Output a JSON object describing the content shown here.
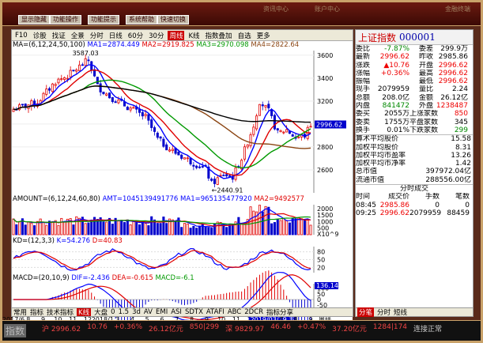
{
  "topbar": {
    "buttons": [
      "显示隐藏",
      "功能操作",
      "功能提示",
      "系统帮助",
      "快速切换"
    ],
    "dim": [
      "资讯中心",
      "账户中心"
    ],
    "right": "金融终端"
  },
  "toolbar": {
    "items": [
      "F10",
      "诊股",
      "找证",
      "全景",
      "分时",
      "日线",
      "60分",
      "30分",
      "周线",
      "K线",
      "指数叠加",
      "自选",
      "更多"
    ],
    "active": "周线"
  },
  "price": {
    "legend": {
      "title": "MA=(6,12,24,50,100)",
      "ma1": "MA1=2874.449",
      "ma2": "MA2=2919.825",
      "ma3": "MA3=2970.098",
      "ma4": "MA4=2822.64"
    },
    "high_label": "3587.03",
    "low_label": "2440.91",
    "yticks": [
      "3600",
      "3400",
      "3200",
      "3000",
      "2800",
      "2600"
    ],
    "last_box": "2996.62"
  },
  "volume": {
    "legend": {
      "title": "AMOUNT=(6,12,24,60,80)",
      "amt": "AMT=1045139491776",
      "ma1": "MA1=965135477920",
      "ma2": "MA2=9492577"
    },
    "yticks": [
      "2000",
      "1500",
      "1000",
      "500"
    ],
    "unit": "X10^9"
  },
  "kd": {
    "legend": {
      "title": "KD=(12,3,3)",
      "k": "K=54.276",
      "d": "D=40.83"
    },
    "yticks": [
      "80",
      "50",
      "20"
    ]
  },
  "macd": {
    "legend": {
      "title": "MACD=(20,10,9)",
      "dif": "DIF=-2.436",
      "dea": "DEA=-0.615",
      "macd": "MACD=-6.1"
    },
    "box": "136.14",
    "yticks": [
      "100",
      "50",
      "0",
      "-50",
      "-100"
    ]
  },
  "xaxis": {
    "labels": [
      "2017/6",
      "8",
      "9",
      "10",
      "11",
      "12",
      "2018/1",
      "3",
      "4",
      "5",
      "6",
      "7",
      "8",
      "9",
      "10",
      "11",
      "12",
      "2019/03/29 五",
      "7",
      "8",
      "9"
    ],
    "period": "周线"
  },
  "bottombar": {
    "items": [
      "常用",
      "指标",
      "技术指标",
      "K线",
      "大盘",
      "0",
      "1.5",
      "3d",
      "AV",
      "EMI",
      "ASI",
      "SDTX",
      "ATAFI",
      "ABC",
      "2DCR",
      "指标分享"
    ],
    "active": "K线"
  },
  "quote": {
    "title": "上证指数",
    "code": "000001",
    "rows": [
      {
        "a": "委比",
        "b": "-7.87%",
        "bc": "grn",
        "c": "委差",
        "d": "299.9万",
        "dc": "blk"
      },
      {
        "a": "最新",
        "b": "2996.62",
        "bc": "red",
        "c": "昨收",
        "d": "2985.86",
        "dc": "blk"
      },
      {
        "a": "涨跌",
        "b": "10.76",
        "bc": "red",
        "c": "开盘",
        "d": "2996.62",
        "dc": "red"
      },
      {
        "a": "涨幅",
        "b": "+0.36%",
        "bc": "red",
        "c": "最高",
        "d": "2996.62",
        "dc": "red"
      },
      {
        "a": "振幅",
        "b": "",
        "bc": "blk",
        "c": "最低",
        "d": "2996.62",
        "dc": "red"
      },
      {
        "a": "现手",
        "b": "2079959",
        "bc": "blk",
        "c": "量比",
        "d": "2.24",
        "dc": "blk"
      },
      {
        "a": "总额",
        "b": "208.0亿",
        "bc": "blk",
        "c": "金额",
        "d": "26.12亿",
        "dc": "blk"
      },
      {
        "a": "内盘",
        "b": "841472",
        "bc": "grn",
        "c": "外盘",
        "d": "1238487",
        "dc": "red"
      },
      {
        "a": "委买",
        "b": "2055万",
        "bc": "blk",
        "c": "上涨家数",
        "d": "850",
        "dc": "red"
      },
      {
        "a": "委卖",
        "b": "1755万",
        "bc": "blk",
        "c": "平盘家数",
        "d": "345",
        "dc": "blk"
      },
      {
        "a": "换手",
        "b": "0.01%",
        "bc": "blk",
        "c": "下跌家数",
        "d": "299",
        "dc": "grn"
      }
    ],
    "stats": [
      {
        "a": "算术平均股价",
        "b": "15.58"
      },
      {
        "a": "加权平均股价",
        "b": "8.31"
      },
      {
        "a": "加权平均市盈率",
        "b": "13.26"
      },
      {
        "a": "加权平均市净率",
        "b": "1.42"
      },
      {
        "a": "总市值",
        "b": "397972.04亿"
      },
      {
        "a": "流通市值",
        "b": "288556.00亿"
      }
    ],
    "ticks_title": "分时成交",
    "ticks_head": [
      "时间",
      "成交价",
      "手数",
      "笔数"
    ],
    "ticks": [
      {
        "t": "08:45",
        "p": "2985.86",
        "v": "0",
        "n": "0"
      },
      {
        "t": "09:25",
        "p": "2996.62",
        "v": "2079959",
        "n": "88459"
      }
    ]
  },
  "qbottom": {
    "items": [
      "分笔",
      "分时",
      "短线"
    ],
    "active": "分笔"
  },
  "status": {
    "label": "指数",
    "items": [
      {
        "n": "沪",
        "v": "2996.62",
        "c": "red"
      },
      {
        "n": "",
        "v": "10.76",
        "c": "red"
      },
      {
        "n": "",
        "v": "+0.36%",
        "c": "red"
      },
      {
        "n": "",
        "v": "26.12亿元",
        "c": "red"
      },
      {
        "n": "",
        "v": "850|299",
        "c": "red"
      },
      {
        "n": "深",
        "v": "9829.97",
        "c": "red"
      },
      {
        "n": "",
        "v": "46.46",
        "c": "red"
      },
      {
        "n": "",
        "v": "+0.47%",
        "c": "red"
      },
      {
        "n": "",
        "v": "37.20亿元",
        "c": "red"
      },
      {
        "n": "",
        "v": "1284|174",
        "c": "red"
      },
      {
        "n": "",
        "v": "连接正常",
        "c": "blk"
      }
    ]
  },
  "colors": {
    "ma1": "#0000ff",
    "ma2": "#e00000",
    "ma3": "#009900",
    "ma4": "#8b4513",
    "up": "#e00000",
    "down": "#0000cc"
  }
}
